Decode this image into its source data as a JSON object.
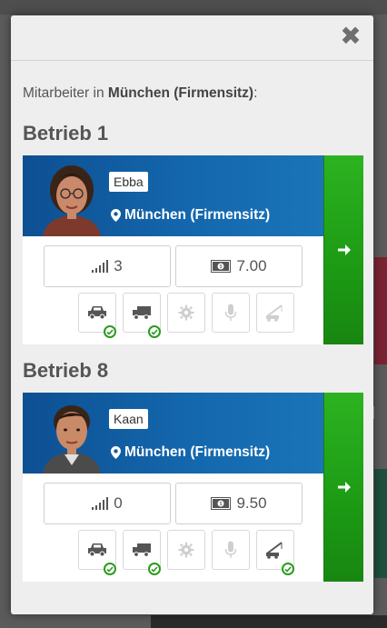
{
  "intro": {
    "prefix": "Mitarbeiter in ",
    "location": "München (Firmensitz)",
    "suffix": ":"
  },
  "groups": [
    {
      "title": "Betrieb 1",
      "employee": {
        "name": "Ebba",
        "location": "München (Firmensitz)",
        "level": "3",
        "salary": "7.00",
        "skills": [
          {
            "icon": "car-icon",
            "active": true,
            "checked": true
          },
          {
            "icon": "truck-icon",
            "active": true,
            "checked": true
          },
          {
            "icon": "gear-icon",
            "active": false,
            "checked": false
          },
          {
            "icon": "microphone-icon",
            "active": false,
            "checked": false
          },
          {
            "icon": "crane-icon",
            "active": false,
            "checked": false
          }
        ]
      }
    },
    {
      "title": "Betrieb 8",
      "employee": {
        "name": "Kaan",
        "location": "München (Firmensitz)",
        "level": "0",
        "salary": "9.50",
        "skills": [
          {
            "icon": "car-icon",
            "active": true,
            "checked": true
          },
          {
            "icon": "truck-icon",
            "active": true,
            "checked": true
          },
          {
            "icon": "gear-icon",
            "active": false,
            "checked": false
          },
          {
            "icon": "microphone-icon",
            "active": false,
            "checked": false
          },
          {
            "icon": "crane-icon",
            "active": true,
            "checked": true
          }
        ]
      }
    }
  ],
  "colors": {
    "card_blue": "#1467ad",
    "go_green": "#1c9a14",
    "check_green": "#2b9a1d"
  }
}
